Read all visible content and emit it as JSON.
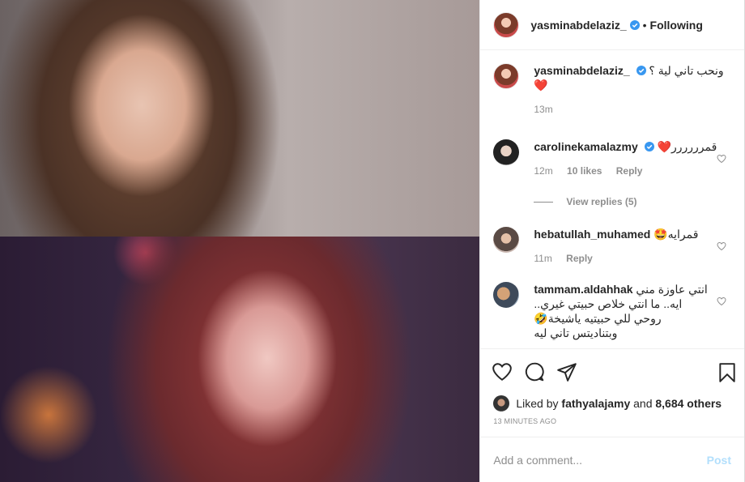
{
  "header": {
    "username": "yasminabdelaziz_",
    "separator": "•",
    "follow_status": "Following"
  },
  "caption": {
    "username": "yasminabdelaziz_",
    "text": "ونحب تاني لية ؟",
    "emoji": "❤️",
    "time": "13m"
  },
  "comments": [
    {
      "username": "carolinekamalazmy",
      "verified": true,
      "text": "قمرررررر❤️",
      "time": "12m",
      "likes": "10 likes",
      "reply": "Reply",
      "view_replies": "View replies (5)"
    },
    {
      "username": "hebatullah_muhamed",
      "verified": false,
      "text": "قمرايه🤩",
      "time": "11m",
      "reply": "Reply"
    },
    {
      "username": "tammam.aldahhak",
      "verified": false,
      "lines": [
        "انتي عاوزة مني",
        "ايه.. ما انتي خلاص حبيتي غيري..",
        "روحي للي حبيتيه ياشيخة🤣",
        "وبتناديتس تاني ليه"
      ]
    }
  ],
  "actions": [
    "heart-icon",
    "comment-icon",
    "share-icon",
    "bookmark-icon"
  ],
  "likes": {
    "prefix": "Liked by",
    "user": "fathyalajamy",
    "middle": "and",
    "others": "8,684 others"
  },
  "timestamp": "13 MINUTES AGO",
  "add_comment": {
    "placeholder": "Add a comment...",
    "post_label": "Post"
  },
  "colors": {
    "verified": "#3897f0",
    "heart": "#ed4956",
    "post_disabled": "#b2dffc"
  }
}
